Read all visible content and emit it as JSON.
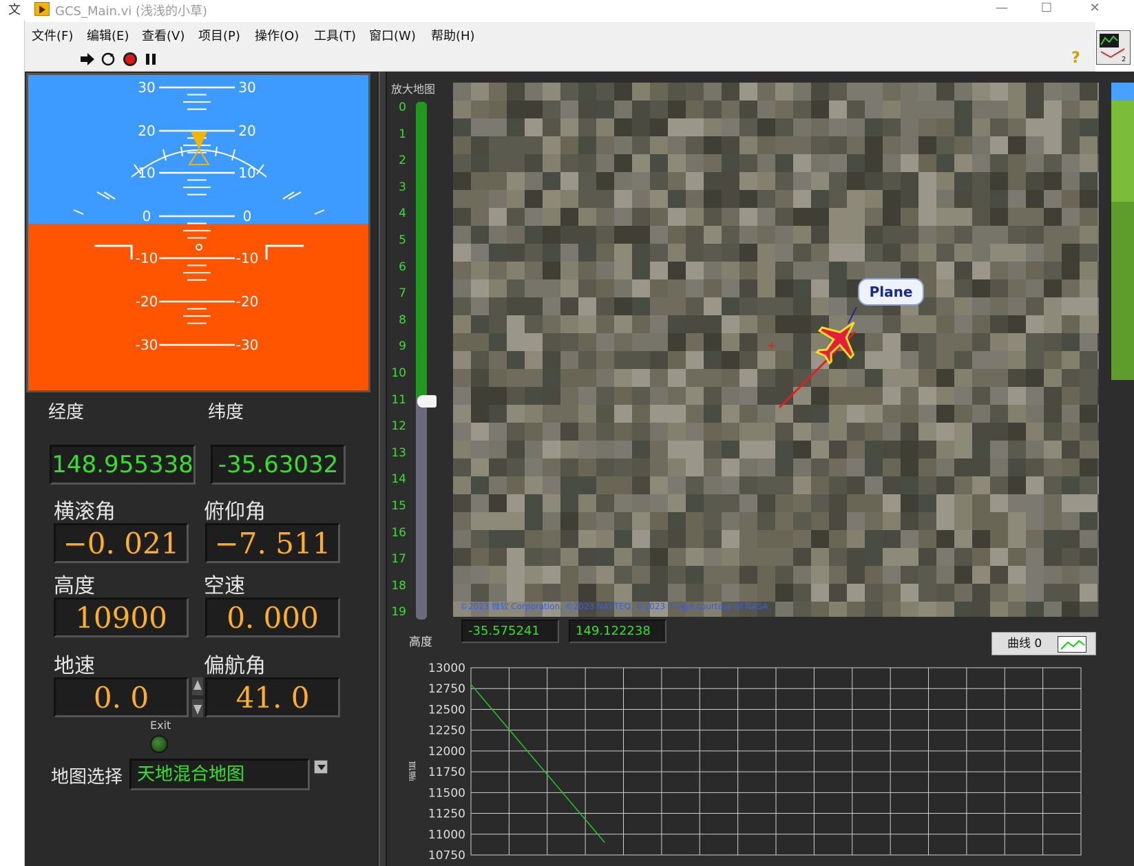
{
  "window": {
    "title": "GCS_Main.vi  (浅浅的小草)",
    "left_strip_char": "文",
    "controls": {
      "minimize": "—",
      "maximize": "☐",
      "close": "✕"
    }
  },
  "menu": [
    "文件(F)",
    "编辑(E)",
    "查看(V)",
    "项目(P)",
    "操作(O)",
    "工具(T)",
    "窗口(W)",
    "帮助(H)"
  ],
  "toolbar": {
    "help": "?",
    "vi_badge": "2"
  },
  "attitude": {
    "roll_deg": -0.021,
    "pitch_deg": -7.511,
    "pitch_left_labels": [
      "30",
      "20",
      "10",
      "0",
      "-10",
      "-20",
      "-30"
    ],
    "pitch_right_labels": [
      "30",
      "20",
      "10",
      "0",
      "-10",
      "-20",
      "-30"
    ],
    "colors": {
      "sky": "#3d9bff",
      "ground": "#ff5500",
      "pointer": "#f5b400"
    }
  },
  "fields": {
    "longitude": {
      "label": "经度",
      "value": "148.955338"
    },
    "latitude": {
      "label": "纬度",
      "value": "-35.63032"
    },
    "roll": {
      "label": "横滚角",
      "value": "−0. 021"
    },
    "pitch": {
      "label": "俯仰角",
      "value": "−7. 511"
    },
    "altitude": {
      "label": "高度",
      "value": "10900"
    },
    "airspeed": {
      "label": "空速",
      "value": "0. 000"
    },
    "groundspeed": {
      "label": "地速",
      "value": "0. 0"
    },
    "heading": {
      "label": "偏航角",
      "value": "41. 0"
    }
  },
  "exit": {
    "label": "Exit"
  },
  "map_select": {
    "label": "地图选择",
    "value": "天地混合地图"
  },
  "zoom": {
    "label": "放大地图",
    "ticks": [
      "0",
      "1",
      "2",
      "3",
      "4",
      "5",
      "6",
      "7",
      "8",
      "9",
      "10",
      "11",
      "12",
      "13",
      "14",
      "15",
      "16",
      "17",
      "18",
      "19"
    ],
    "value": 11
  },
  "map": {
    "marker_label": "Plane",
    "copyright": "©2023 微软 Corporation, ©2023 NAVTEQ, ©2023 Image courtesy of NASA"
  },
  "coords": {
    "lat_value": "-35.575241",
    "lon_value": "149.122238"
  },
  "chart": {
    "legend": "曲线 0",
    "left_title": "高度",
    "ylabel": "幅值",
    "color": "#23c823"
  },
  "chart_data": {
    "type": "line",
    "ylim": [
      10750,
      13000
    ],
    "yticks": [
      "13000",
      "12750",
      "12500",
      "12250",
      "12000",
      "11750",
      "11500",
      "11250",
      "11000",
      "10750"
    ],
    "x": [
      0,
      34
    ],
    "xlim": [
      0,
      155
    ],
    "series": [
      {
        "values": [
          12800,
          10900
        ]
      }
    ],
    "grid": true
  }
}
